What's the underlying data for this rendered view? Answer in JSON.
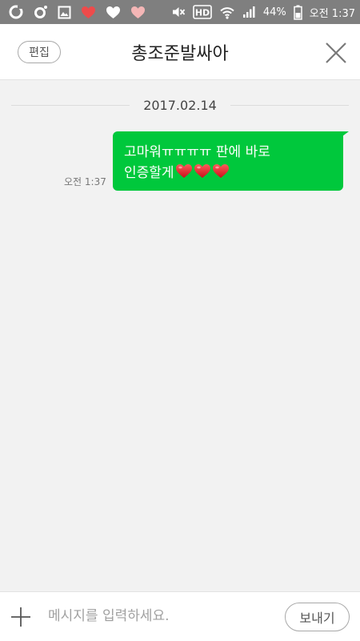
{
  "status_bar": {
    "battery_percent": "44%",
    "time": "오전 1:37",
    "icons": [
      "o-circle-icon",
      "o-dot-icon",
      "image-icon",
      "heart-icon",
      "heart-icon",
      "heart-icon",
      "mute-icon",
      "hd-icon",
      "wifi-icon",
      "signal-icon",
      "battery-icon"
    ],
    "colors": {
      "background": "#7f7f7f",
      "heart_red": "#ee4b4b",
      "heart_white": "#ffffff",
      "heart_pink": "#f4b6b6"
    }
  },
  "header": {
    "edit_label": "편집",
    "title": "총조준발싸아",
    "close_icon": "close-icon"
  },
  "chat": {
    "date": "2017.02.14",
    "messages": [
      {
        "line1": "고마워ㅠㅠㅠㅠ 판에 바로",
        "line2": "인증할게",
        "hearts": [
          "heart-emoji-icon",
          "heart-emoji-icon",
          "heart-emoji-icon"
        ],
        "time": "오전 1:37",
        "bubble_color": "#00c83c"
      }
    ]
  },
  "input_bar": {
    "placeholder": "메시지를 입력하세요.",
    "send_label": "보내기",
    "plus_icon": "plus-icon"
  }
}
